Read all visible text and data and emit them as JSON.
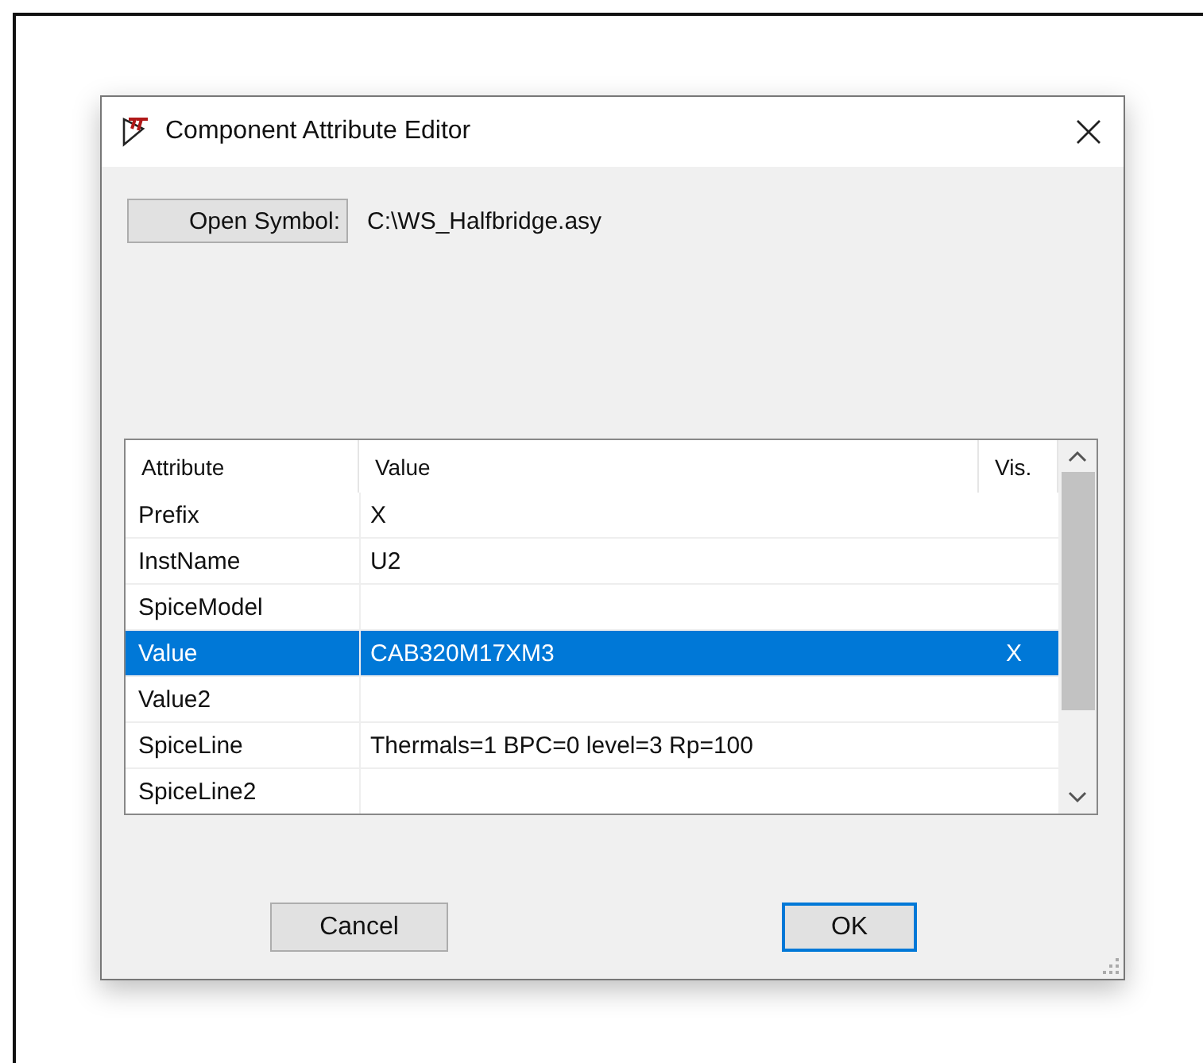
{
  "window": {
    "title": "Component Attribute Editor"
  },
  "open_symbol": {
    "button": "Open Symbol:",
    "path": "C:\\WS_Halfbridge.asy"
  },
  "table": {
    "columns": [
      "Attribute",
      "Value",
      "Vis."
    ],
    "rows": [
      {
        "attribute": "Prefix",
        "value": "X",
        "selected": false
      },
      {
        "attribute": "InstName",
        "value": "U2",
        "selected": false
      },
      {
        "attribute": "SpiceModel",
        "selected": false
      },
      {
        "attribute": "Value",
        "value": "CAB320M17XM3",
        "vis": "X",
        "selected": true
      },
      {
        "attribute": "Value2",
        "selected": false
      },
      {
        "attribute": "SpiceLine",
        "value": "Thermals=1 BPC=0 level=3 Rp=100",
        "selected": false
      },
      {
        "attribute": "SpiceLine2",
        "selected": false
      }
    ]
  },
  "buttons": [
    {
      "label": "Cancel",
      "focused": false
    },
    {
      "label": "OK",
      "focused": true
    }
  ]
}
